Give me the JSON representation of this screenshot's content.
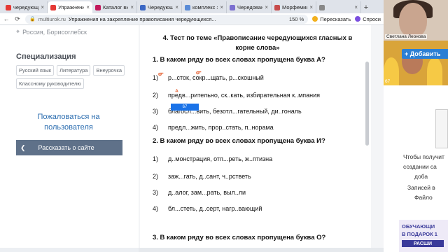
{
  "colors": {
    "tabbar_bg": "#dfe3ea",
    "link_blue": "#2d6eb0",
    "share_btn_bg": "#5f7189",
    "accent_blue": "#1a73e8",
    "pen_mark": "#e8734a"
  },
  "tabs": [
    {
      "label": "чередующиес",
      "icon": "youtube-icon",
      "color": "#e53935",
      "active": false
    },
    {
      "label": "Упражнения",
      "icon": "youtube-icon",
      "color": "#e53935",
      "active": true
    },
    {
      "label": "Каталог видео",
      "icon": "rutube-icon",
      "color": "#c2185b",
      "active": false
    },
    {
      "label": "Чередующие",
      "icon": "multiurok-icon",
      "color": "#3a66c4",
      "active": false
    },
    {
      "label": "комплекс зада",
      "icon": "doc-icon",
      "color": "#5a8bd6",
      "active": false
    },
    {
      "label": "Чередование",
      "icon": "cloud-icon",
      "color": "#7b6fd0",
      "active": false
    },
    {
      "label": "Морфемика и",
      "icon": "school-icon",
      "color": "#c74b4b",
      "active": false
    },
    {
      "label": "",
      "icon": "globe-icon",
      "color": "#888888",
      "active": false
    }
  ],
  "address_bar": {
    "host": "multiurok.ru",
    "title": "Упражнения на закрепление правописания чередующихся...",
    "zoom": "150 %",
    "retell_label": "Пересказать",
    "ask_label": "Спроси"
  },
  "sidebar": {
    "city": "Россия, Борисоглебск",
    "spec_title": "Специализация",
    "tags": [
      "Русский язык",
      "Литература",
      "Внеурочка",
      "Классному руководителю"
    ],
    "complain": "Пожаловаться на пользователя",
    "share": "Рассказать о сайте"
  },
  "document": {
    "heading": "4. Тест по теме «Правописание чередующихся гласных в корне слова»",
    "questions": [
      {
        "text": "1.   В каком ряду во всех словах пропущена буква А?",
        "options": [
          {
            "num": "1)",
            "text": "р...сток, сокр...щать, р...скошный"
          },
          {
            "num": "2)",
            "text": "предв...рительно, ск..кать, избирательная к..мпания"
          },
          {
            "num": "3)",
            "text": "благосл...вить, безотл...гательный, ди..гональ"
          },
          {
            "num": "4)",
            "text": "предл...жить, прор..стать, п..норама"
          }
        ]
      },
      {
        "text": "2.   В каком ряду во всех словах пропущена буква И?",
        "options": [
          {
            "num": "1)",
            "text": "д..монстрация, отп...реть, ж..птизна"
          },
          {
            "num": "2)",
            "text": "заж...гать, д..сант, ч..рстветь"
          },
          {
            "num": "3)",
            "text": "д..алог, зам...рать, выл..ли"
          },
          {
            "num": "4)",
            "text": "бл...стеть, д..серт, нагр..вающий"
          }
        ]
      },
      {
        "text": "3.   В каком ряду во всех словах пропущена буква О?",
        "options": []
      }
    ],
    "page_badge": "67"
  },
  "right_panel": {
    "cam1_name": "Светлана Леонова",
    "cam2_num": "67",
    "add_button": "+ Добавить",
    "side_lines": [
      "Чтобы получит",
      "создании са",
      "доба",
      "Записей в",
      "Файло"
    ],
    "promo": [
      "ОБУЧАЮЩИ",
      "В ПОДАРОК 1",
      "РАСШИ"
    ]
  }
}
